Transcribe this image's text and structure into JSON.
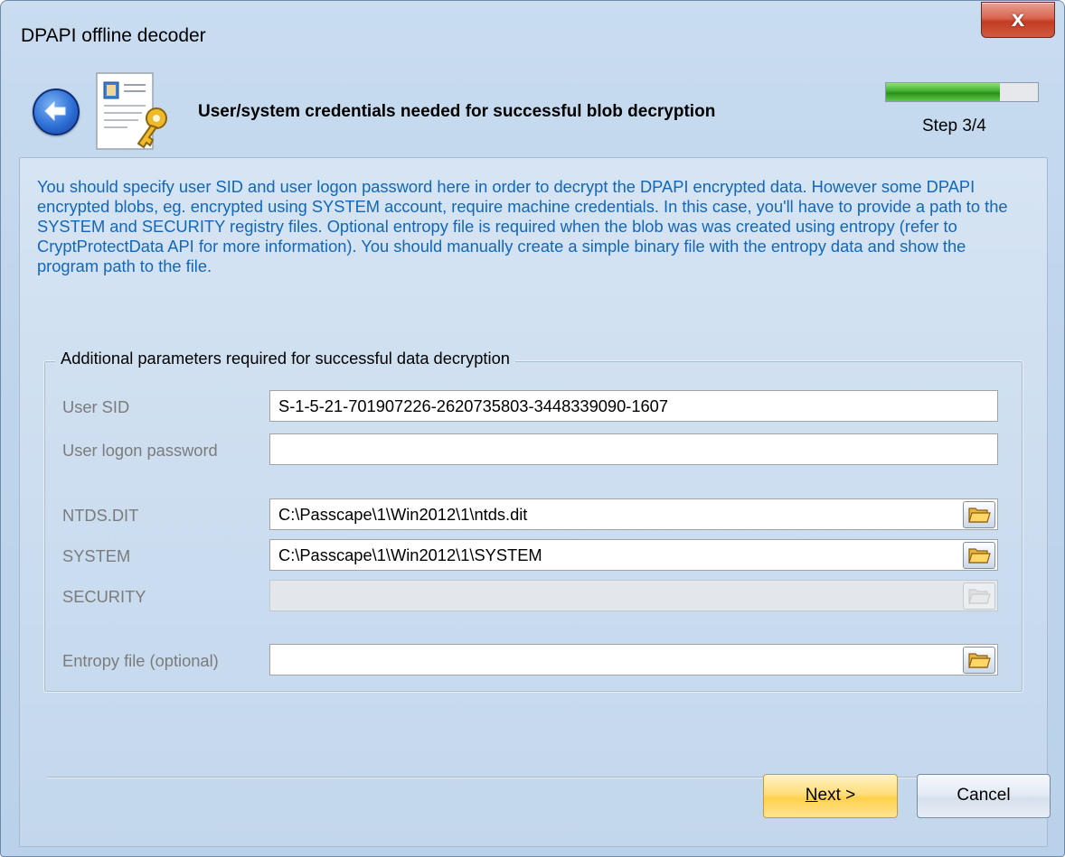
{
  "window": {
    "title": "DPAPI offline decoder",
    "close_label": "x"
  },
  "header": {
    "title": "User/system credentials needed for successful blob decryption",
    "step": "Step 3/4",
    "progress_percent": 75
  },
  "description": "You should specify user SID and user logon password here in order to decrypt the DPAPI encrypted data. However some DPAPI encrypted blobs, eg. encrypted using SYSTEM account, require machine credentials. In this case, you'll have to provide a path to the SYSTEM and SECURITY registry files. Optional entropy file is required when the blob was was created using entropy (refer to CryptProtectData API for more information). You should manually create a simple binary file with the entropy data and show the program path to the file.",
  "group": {
    "title": "Additional parameters required for successful data decryption",
    "fields": {
      "user_sid": {
        "label": "User SID",
        "value": "S-1-5-21-701907226-2620735803-3448339090-1607"
      },
      "password": {
        "label": "User logon password",
        "value": ""
      },
      "ntds": {
        "label": "NTDS.DIT",
        "value": "C:\\Passcape\\1\\Win2012\\1\\ntds.dit"
      },
      "system": {
        "label": "SYSTEM",
        "value": "C:\\Passcape\\1\\Win2012\\1\\SYSTEM"
      },
      "security": {
        "label": "SECURITY",
        "value": ""
      },
      "entropy": {
        "label": "Entropy file (optional)",
        "value": ""
      }
    }
  },
  "buttons": {
    "next_underlined": "N",
    "next_rest": "ext >",
    "cancel": "Cancel"
  },
  "icons": {
    "back": "back-arrow-icon",
    "document": "document-key-icon",
    "browse": "folder-open-icon"
  },
  "colors": {
    "description_text": "#1267b9",
    "progress": "#3fb02a",
    "close": "#c23b22"
  }
}
